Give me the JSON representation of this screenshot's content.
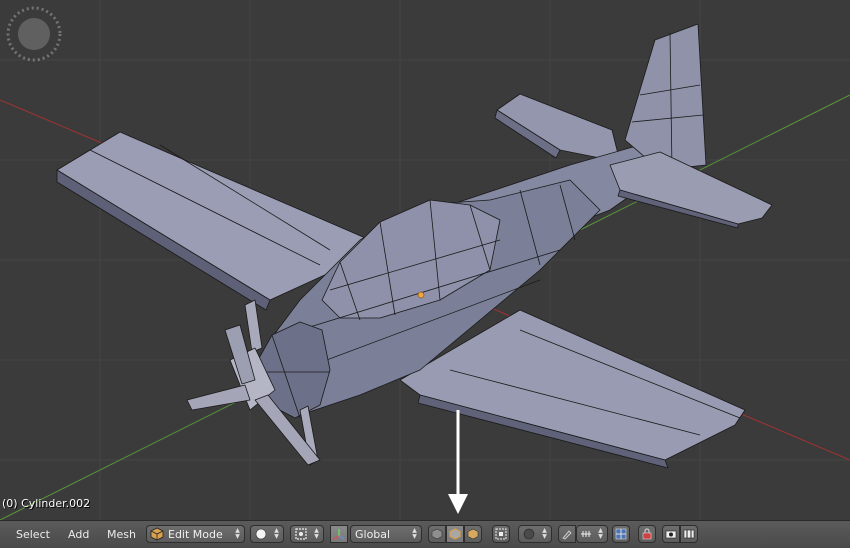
{
  "viewport": {
    "object_label": "(0) Cylinder.002"
  },
  "header": {
    "menus": [
      {
        "label": "Select"
      },
      {
        "label": "Add"
      },
      {
        "label": "Mesh"
      }
    ],
    "mode_label": "Edit Mode",
    "orientation_label": "Global"
  },
  "icons": {
    "mode": "edit-mode-cube-icon",
    "shading": "solid-shading-sphere-icon",
    "pivot": "pivot-point-icon",
    "manipulator": "transform-manipulator-icon",
    "vertex_select": "vertex-select-icon",
    "edge_select": "edge-select-icon",
    "face_select": "face-select-icon",
    "occlude": "limit-selection-to-visible-icon",
    "proportional": "proportional-editing-icon",
    "snap": "snap-magnet-icon",
    "snap_element": "snap-element-icon",
    "mirror": "mirror-icon",
    "lock": "lock-icon",
    "render_still": "render-camera-icon",
    "render_anim": "render-animation-icon"
  },
  "colors": {
    "background": "#3b3b3b",
    "grid": "#454545",
    "x_axis": "#a03333",
    "y_axis": "#5a9a3a",
    "mesh": "#8b8ea6",
    "edges": "#1a1a1a",
    "header": "#4f4f4f",
    "origin": "#f3a43c",
    "arrow": "#ffffff"
  }
}
